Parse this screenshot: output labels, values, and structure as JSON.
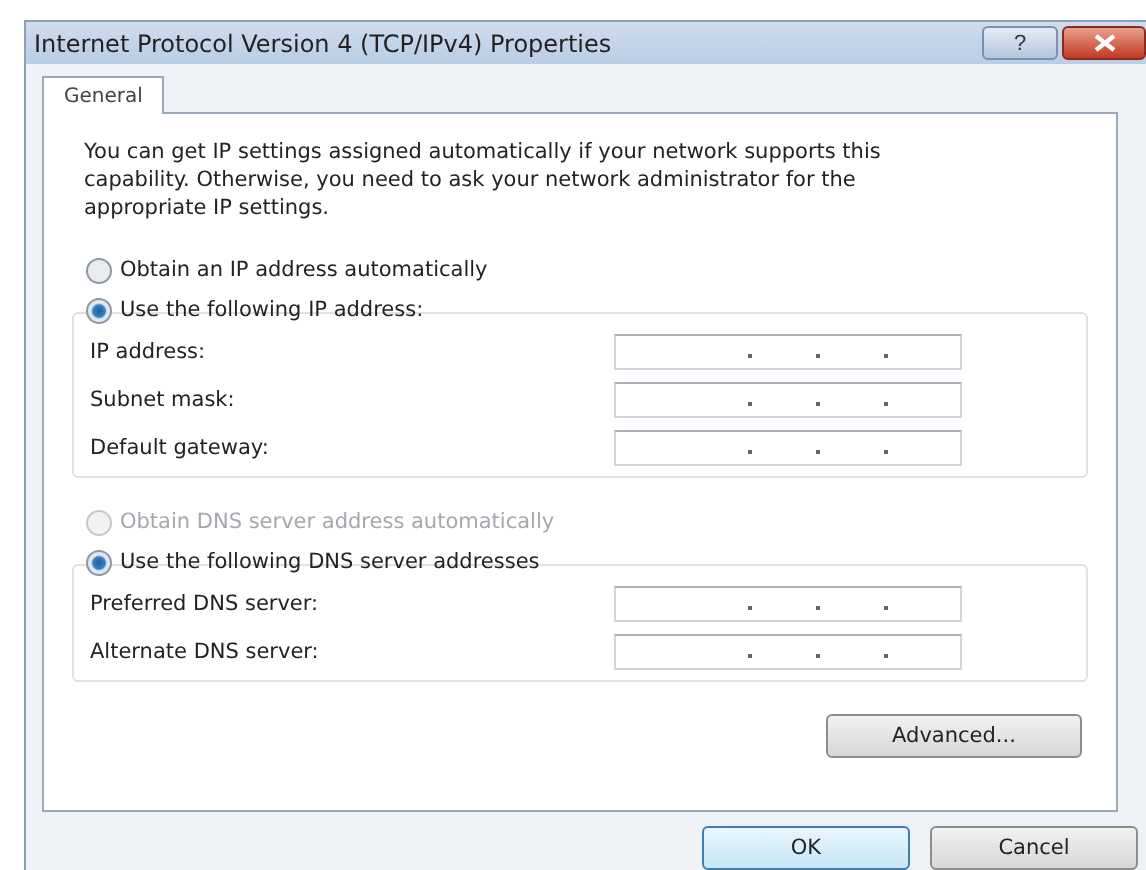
{
  "window": {
    "title": "Internet Protocol Version 4 (TCP/IPv4) Properties",
    "help_button": "?"
  },
  "tabs": [
    {
      "label": "General",
      "selected": true
    }
  ],
  "description": "You can get IP settings assigned automatically if your network supports this capability. Otherwise, you need to ask your network administrator for the appropriate IP settings.",
  "ip_options": [
    {
      "label": "Obtain an IP address automatically",
      "selected": false,
      "disabled": false
    },
    {
      "label": "Use the following IP address:",
      "selected": true,
      "disabled": false
    }
  ],
  "ip_fields": [
    {
      "label": "IP address:"
    },
    {
      "label": "Subnet mask:"
    },
    {
      "label": "Default gateway:"
    }
  ],
  "dns_options": [
    {
      "label": "Obtain DNS server address automatically",
      "selected": false,
      "disabled": true
    },
    {
      "label": "Use the following DNS server addresses",
      "selected": true,
      "disabled": false
    }
  ],
  "dns_fields": [
    {
      "label": "Preferred DNS server:"
    },
    {
      "label": "Alternate DNS server:"
    }
  ],
  "advanced_button": "Advanced...",
  "buttons": [
    {
      "label": "OK",
      "default": true
    },
    {
      "label": "Cancel",
      "default": false
    }
  ]
}
